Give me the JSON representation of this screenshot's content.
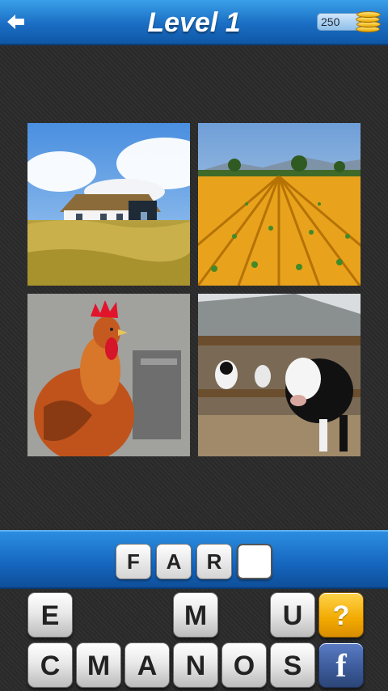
{
  "header": {
    "title": "Level 1",
    "coins": "250",
    "back_icon": "back-arrow-icon",
    "coin_icon": "coin-stack-icon"
  },
  "pictures": [
    {
      "subject": "house"
    },
    {
      "subject": "field"
    },
    {
      "subject": "rooster"
    },
    {
      "subject": "cows"
    }
  ],
  "answer": {
    "slots": [
      "F",
      "A",
      "R",
      ""
    ]
  },
  "keyboard": {
    "row1": [
      "E",
      "",
      "",
      "M",
      "",
      "U"
    ],
    "row2": [
      "C",
      "M",
      "A",
      "N",
      "O",
      "S"
    ],
    "hint_label": "?",
    "facebook_label": "f"
  },
  "colors": {
    "header_blue": "#1a6ec4",
    "hint_orange": "#f2a900",
    "facebook_blue": "#3b5998"
  }
}
